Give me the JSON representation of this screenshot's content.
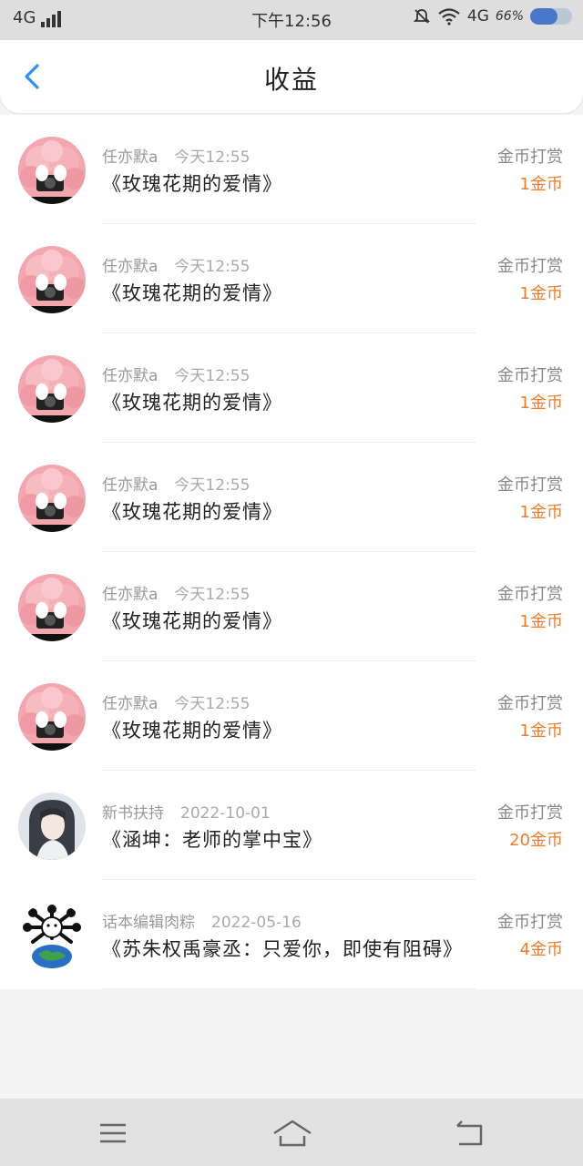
{
  "status_bar": {
    "network": "4G",
    "time": "下午12:56",
    "right_network": "4G",
    "battery_text": "66%",
    "battery_level": 0.66
  },
  "header": {
    "title": "收益",
    "back_icon": "chevron-left-icon"
  },
  "accent_colors": {
    "amount": "#ee7d2c",
    "back": "#2d8ff0"
  },
  "records": [
    {
      "user": "任亦默a",
      "time": "今天12:55",
      "book": "《玫瑰花期的爱情》",
      "type": "金币打赏",
      "amount": "1金币",
      "avatar": "pink"
    },
    {
      "user": "任亦默a",
      "time": "今天12:55",
      "book": "《玫瑰花期的爱情》",
      "type": "金币打赏",
      "amount": "1金币",
      "avatar": "pink"
    },
    {
      "user": "任亦默a",
      "time": "今天12:55",
      "book": "《玫瑰花期的爱情》",
      "type": "金币打赏",
      "amount": "1金币",
      "avatar": "pink"
    },
    {
      "user": "任亦默a",
      "time": "今天12:55",
      "book": "《玫瑰花期的爱情》",
      "type": "金币打赏",
      "amount": "1金币",
      "avatar": "pink"
    },
    {
      "user": "任亦默a",
      "time": "今天12:55",
      "book": "《玫瑰花期的爱情》",
      "type": "金币打赏",
      "amount": "1金币",
      "avatar": "pink"
    },
    {
      "user": "任亦默a",
      "time": "今天12:55",
      "book": "《玫瑰花期的爱情》",
      "type": "金币打赏",
      "amount": "1金币",
      "avatar": "pink"
    },
    {
      "user": "新书扶持",
      "time": "2022-10-01",
      "book": "《涵坤：老师的掌中宝》",
      "type": "金币打赏",
      "amount": "20金币",
      "avatar": "portrait"
    },
    {
      "user": "话本编辑肉粽",
      "time": "2022-05-16",
      "book": "《苏朱权禹豪丞：只爱你，即使有阻碍》",
      "type": "金币打赏",
      "amount": "4金币",
      "avatar": "earth"
    }
  ],
  "nav_bar": {
    "menu_icon": "menu-icon",
    "home_icon": "home-icon",
    "back_icon": "back-arrow-icon"
  }
}
